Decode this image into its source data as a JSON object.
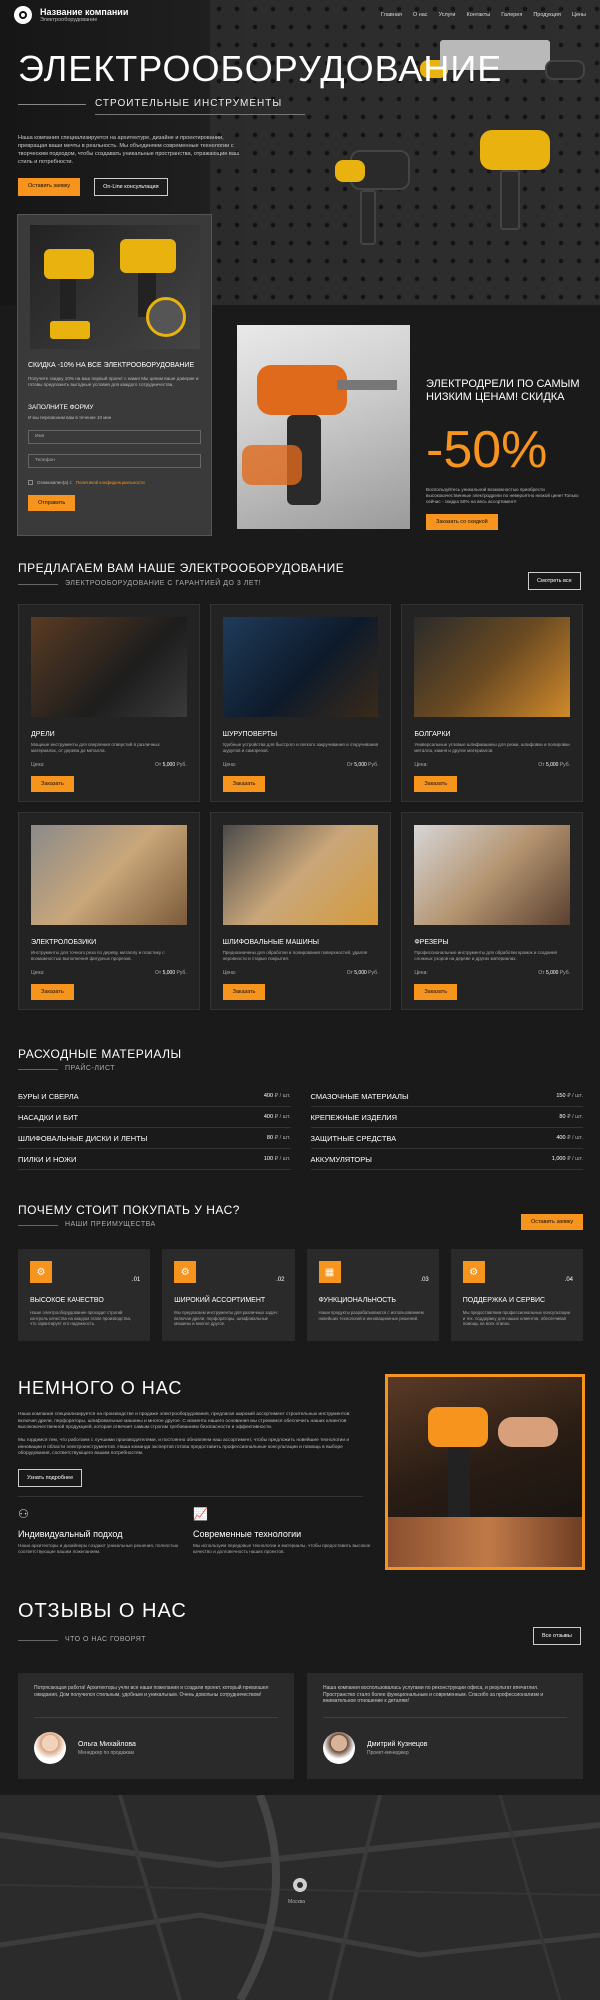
{
  "header": {
    "brand_name": "Название компании",
    "brand_sub": "Электрооборудование",
    "nav": [
      "Главная",
      "О нас",
      "Услуги",
      "Контакты",
      "Галерея",
      "Продукция",
      "Цены"
    ]
  },
  "hero": {
    "title": "ЭЛЕКТРООБОРУДОВАНИЕ",
    "subtitle": "СТРОИТЕЛЬНЫЕ ИНСТРУМЕНТЫ",
    "text": "Наша компания специализируется на архитектуре, дизайне и проектировании, превращая ваши мечты в реальность. Мы объединяем современные технологии с творческим подходом, чтобы создавать уникальные пространства, отражающие ваш стиль и потребности.",
    "btn_order": "Оставить заявку",
    "btn_consult": "On-Line консультация"
  },
  "promo": {
    "title": "СКИДКА -10% НА ВСЕ ЭЛЕКТРООБОРУДОВАНИЕ",
    "text": "Получите скидку 10% на ваш первый проект с нами! Мы ценим ваше доверие и готовы предложить выгодные условия для каждого сотрудничества.",
    "form_title": "ЗАПОЛНИТЕ ФОРМУ",
    "form_sub": "И мы перезвоним вам в течение 10 мин",
    "name_placeholder": "Имя",
    "phone_placeholder": "Телефон",
    "consent_text": "Ознакомлен(а) с",
    "consent_link": "Политикой конфиденциальности",
    "submit": "Отправить"
  },
  "sale": {
    "title": "ЭЛЕКТРОДРЕЛИ ПО САМЫМ НИЗКИМ ЦЕНАМ! СКИДКА",
    "percent": "-50%",
    "text": "Воспользуйтесь уникальной возможностью приобрести высококачественные электродрели по невероятно низкой цене! Только сейчас - скидка 50% на весь ассортимент!",
    "btn": "Заказать со скидкой"
  },
  "products": {
    "title": "ПРЕДЛАГАЕМ ВАМ НАШЕ ЭЛЕКТРООБОРУДОВАНИЕ",
    "subtitle": "ЭЛЕКТРООБОРУДОВАНИЕ С ГАРАНТИЕЙ ДО 3 ЛЕТ!",
    "view_all": "Смотреть все",
    "price_label": "Цена:",
    "price_from": "От",
    "order_btn": "Заказать",
    "items": [
      {
        "name": "ДРЕЛИ",
        "desc": "Мощные инструменты для сверления отверстий в различных материалах, от дерева до металла.",
        "price": "5,000",
        "currency": "Руб."
      },
      {
        "name": "ШУРУПОВЕРТЫ",
        "desc": "Удобные устройства для быстрого и легкого закручивания и откручивания шурупов и саморезов.",
        "price": "5,000",
        "currency": "Руб."
      },
      {
        "name": "БОЛГАРКИ",
        "desc": "Универсальные угловые шлифмашины для резки, шлифовки и полировки металла, камня и других материалов.",
        "price": "5,000",
        "currency": "Руб."
      },
      {
        "name": "ЭЛЕКТРОЛОБЗИКИ",
        "desc": "Инструменты для точного реза по дереву, металлу и пластику с возможностью выполнения фигурных прорезов.",
        "price": "5,000",
        "currency": "Руб."
      },
      {
        "name": "ШЛИФОВАЛЬНЫЕ МАШИНЫ",
        "desc": "Предназначены для обработки и полирования поверхностей, удаляя неровности и старые покрытия.",
        "price": "5,000",
        "currency": "Руб."
      },
      {
        "name": "ФРЕЗЕРЫ",
        "desc": "Профессиональные инструменты для обработки кромок и создания сложных узоров на дереве и других материалах.",
        "price": "5,000",
        "currency": "Руб."
      }
    ]
  },
  "consumables": {
    "title": "РАСХОДНЫЕ МАТЕРИАЛЫ",
    "subtitle": "ПРАЙС-ЛИСТ",
    "items": [
      {
        "name": "БУРЫ И СВЕРЛА",
        "price": "400",
        "unit": "₽ / шт."
      },
      {
        "name": "СМАЗОЧНЫЕ МАТЕРИАЛЫ",
        "price": "150",
        "unit": "₽ / шт."
      },
      {
        "name": "НАСАДКИ И БИТ",
        "price": "400",
        "unit": "₽ / шт."
      },
      {
        "name": "КРЕПЕЖНЫЕ ИЗДЕЛИЯ",
        "price": "80",
        "unit": "₽ / шт."
      },
      {
        "name": "ШЛИФОВАЛЬНЫЕ ДИСКИ И ЛЕНТЫ",
        "price": "80",
        "unit": "₽ / шт."
      },
      {
        "name": "ЗАЩИТНЫЕ СРЕДСТВА",
        "price": "400",
        "unit": "₽ / шт."
      },
      {
        "name": "ПИЛКИ И НОЖИ",
        "price": "100",
        "unit": "₽ / шт."
      },
      {
        "name": "АККУМУЛЯТОРЫ",
        "price": "1,000",
        "unit": "₽ / шт."
      }
    ]
  },
  "why": {
    "title": "ПОЧЕМУ СТОИТ ПОКУПАТЬ У НАС?",
    "subtitle": "НАШИ ПРЕИМУЩЕСТВА",
    "btn": "Оставить заявку",
    "items": [
      {
        "num": ".01",
        "title": "ВЫСОКОЕ КАЧЕСТВО",
        "text": "Наше электрооборудование проходит строгий контроль качества на каждом этапе производства, что гарантирует его надежность."
      },
      {
        "num": ".02",
        "title": "ШИРОКИЙ АССОРТИМЕНТ",
        "text": "Мы предлагаем инструменты для различных задач: включая дрели, перфораторы, шлифовальные машины и многое другое."
      },
      {
        "num": ".03",
        "title": "ФУНКЦИОНАЛЬНОСТЬ",
        "text": "Наши продукты разрабатываются с использованием новейших технологий и инновационных решений."
      },
      {
        "num": ".04",
        "title": "ПОДДЕРЖКА И СЕРВИС",
        "text": "Мы предоставляем профессиональные консультации и тех. поддержку для наших клиентов, обеспечивая помощь на всех этапах."
      }
    ]
  },
  "about": {
    "title": "НЕМНОГО О НАС",
    "p1": "Наша компания специализируется на производстве и продаже электрооборудования, предлагая широкий ассортимент строительных инструментов: включая дрели, перфораторы, шлифовальные машины и многое другое. С момента нашего основания мы стремимся обеспечить наших клиентов высококачественной продукцией, которая отвечает самым строгим требованиям безопасности и эффективности.",
    "p2": "Мы гордимся тем, что работаем с лучшими производителями, и постоянно обновляем наш ассортимент, чтобы предложить новейшие технологии и инновации в области электроинструментов. Наша команда экспертов готова предоставить профессиональные консультации и помощь в выборе оборудования, соответствующего вашим потребностям.",
    "btn": "Узнать подробнее",
    "features": [
      {
        "title": "Индивидуальный подход",
        "text": "Наши архитекторы и дизайнеры создают уникальные решения, полностью соответствующие вашим пожеланиям."
      },
      {
        "title": "Современные технологии",
        "text": "Мы используем передовые технологии и материалы, чтобы предоставить высокое качество и долговечность наших проектов."
      }
    ]
  },
  "reviews": {
    "title": "ОТЗЫВЫ О НАС",
    "subtitle": "ЧТО О НАС ГОВОРЯТ",
    "btn": "Все отзывы",
    "items": [
      {
        "text": "Потрясающая работа! Архитекторы учли все наши пожелания и создали проект, который превзошел ожидания. Дом получился стильным, удобным и уникальным. Очень довольны сотрудничеством!",
        "name": "Ольга Михайлова",
        "role": "Менеджер по продажам"
      },
      {
        "text": "Наша компания воспользовалась услугами по реконструкции офиса, и результат впечатлил. Пространство стало более функциональным и современным. Спасибо за профессионализм и внимательное отношение к деталям!",
        "name": "Дмитрий Кузнецов",
        "role": "Проект-менеджер"
      }
    ]
  },
  "map": {
    "city": "Москва"
  },
  "colors": {
    "accent": "#f7941d",
    "bg": "#1a1a1a",
    "card": "#232323"
  }
}
